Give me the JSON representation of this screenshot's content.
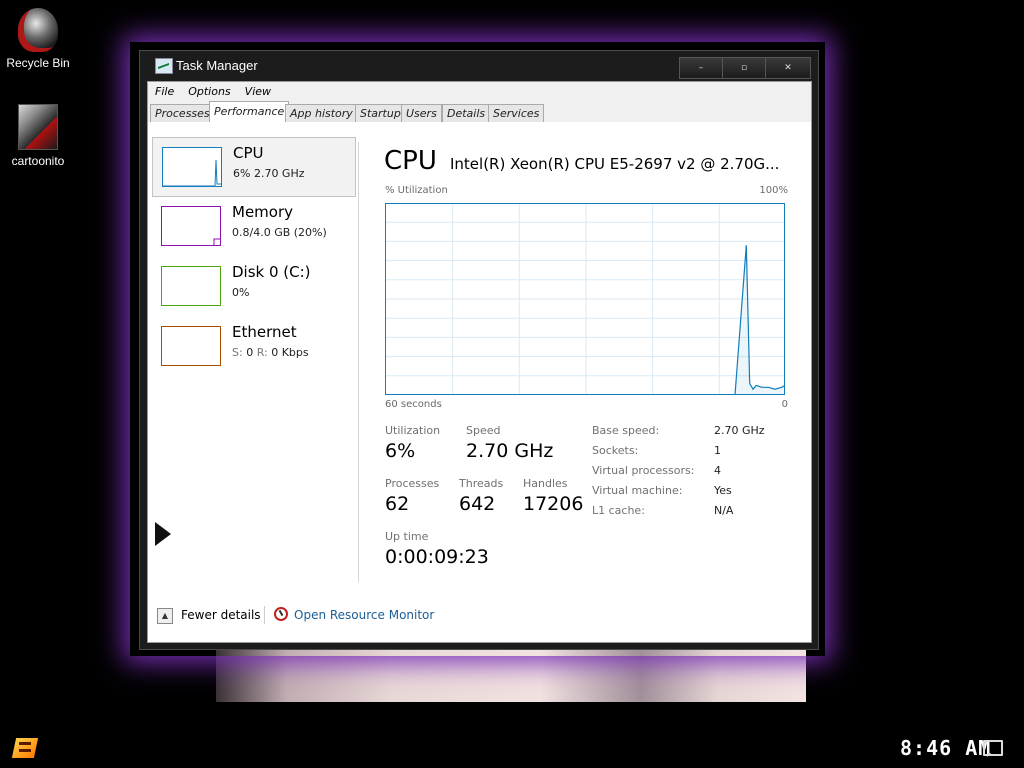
{
  "desktop": {
    "icons": [
      {
        "label": "Recycle Bin",
        "icon": "recycle-bin-icon"
      },
      {
        "label": "cartoonito",
        "icon": "shortcut-icon"
      }
    ]
  },
  "window": {
    "title": "Task Manager",
    "controls": {
      "minimize": "–",
      "maximize": "▫",
      "close": "✕"
    }
  },
  "menu": [
    "File",
    "Options",
    "View"
  ],
  "tabs": [
    {
      "label": "Processes",
      "active": false
    },
    {
      "label": "Performance",
      "active": true
    },
    {
      "label": "App history",
      "active": false
    },
    {
      "label": "Startup",
      "active": false
    },
    {
      "label": "Users",
      "active": false
    },
    {
      "label": "Details",
      "active": false
    },
    {
      "label": "Services",
      "active": false
    }
  ],
  "sidebar": [
    {
      "title": "CPU",
      "sub": "6%  2.70 GHz",
      "color": "#117dbb",
      "selected": true
    },
    {
      "title": "Memory",
      "sub": "0.8/4.0 GB (20%)",
      "color": "#8b12ae",
      "selected": false
    },
    {
      "title": "Disk 0 (C:)",
      "sub": "0%",
      "color": "#4da60c",
      "selected": false
    },
    {
      "title": "Ethernet",
      "sub_s_label": "S:",
      "sub_s": "0",
      "sub_r_label": "R:",
      "sub_r": "0 Kbps",
      "color": "#a74f01",
      "selected": false
    }
  ],
  "main": {
    "heading": "CPU",
    "model": "Intel(R) Xeon(R) CPU E5-2697 v2 @ 2.70G...",
    "graph_top_left": "% Utilization",
    "graph_top_right": "100%",
    "graph_bottom_left": "60 seconds",
    "graph_bottom_right": "0",
    "line_color": "#117dbb",
    "grid_color": "#d9eaf4",
    "stats": {
      "utilization_label": "Utilization",
      "utilization": "6%",
      "speed_label": "Speed",
      "speed": "2.70 GHz",
      "processes_label": "Processes",
      "processes": "62",
      "threads_label": "Threads",
      "threads": "642",
      "handles_label": "Handles",
      "handles": "17206",
      "uptime_label": "Up time",
      "uptime": "0:00:09:23"
    },
    "details": [
      {
        "key": "Base speed:",
        "value": "2.70 GHz"
      },
      {
        "key": "Sockets:",
        "value": "1"
      },
      {
        "key": "Virtual processors:",
        "value": "4"
      },
      {
        "key": "Virtual machine:",
        "value": "Yes"
      },
      {
        "key": "L1 cache:",
        "value": "N/A"
      }
    ]
  },
  "footer": {
    "fewer_details": "Fewer details",
    "resource_monitor": "Open Resource Monitor"
  },
  "taskbar": {
    "clock": "8:46 AM"
  },
  "chart_data": {
    "type": "line",
    "ylabel": "% Utilization",
    "ylim": [
      0,
      100
    ],
    "xlim": [
      60,
      0
    ],
    "grid": true,
    "series": [
      {
        "x": [
          60,
          8,
          7.5,
          5.8,
          5.3,
          4.8,
          4.3,
          3.5,
          2.5,
          1.5,
          0.5,
          0
        ],
        "values": [
          0,
          0,
          0,
          78,
          6,
          3,
          5,
          4,
          4,
          3,
          4,
          5
        ]
      }
    ]
  }
}
